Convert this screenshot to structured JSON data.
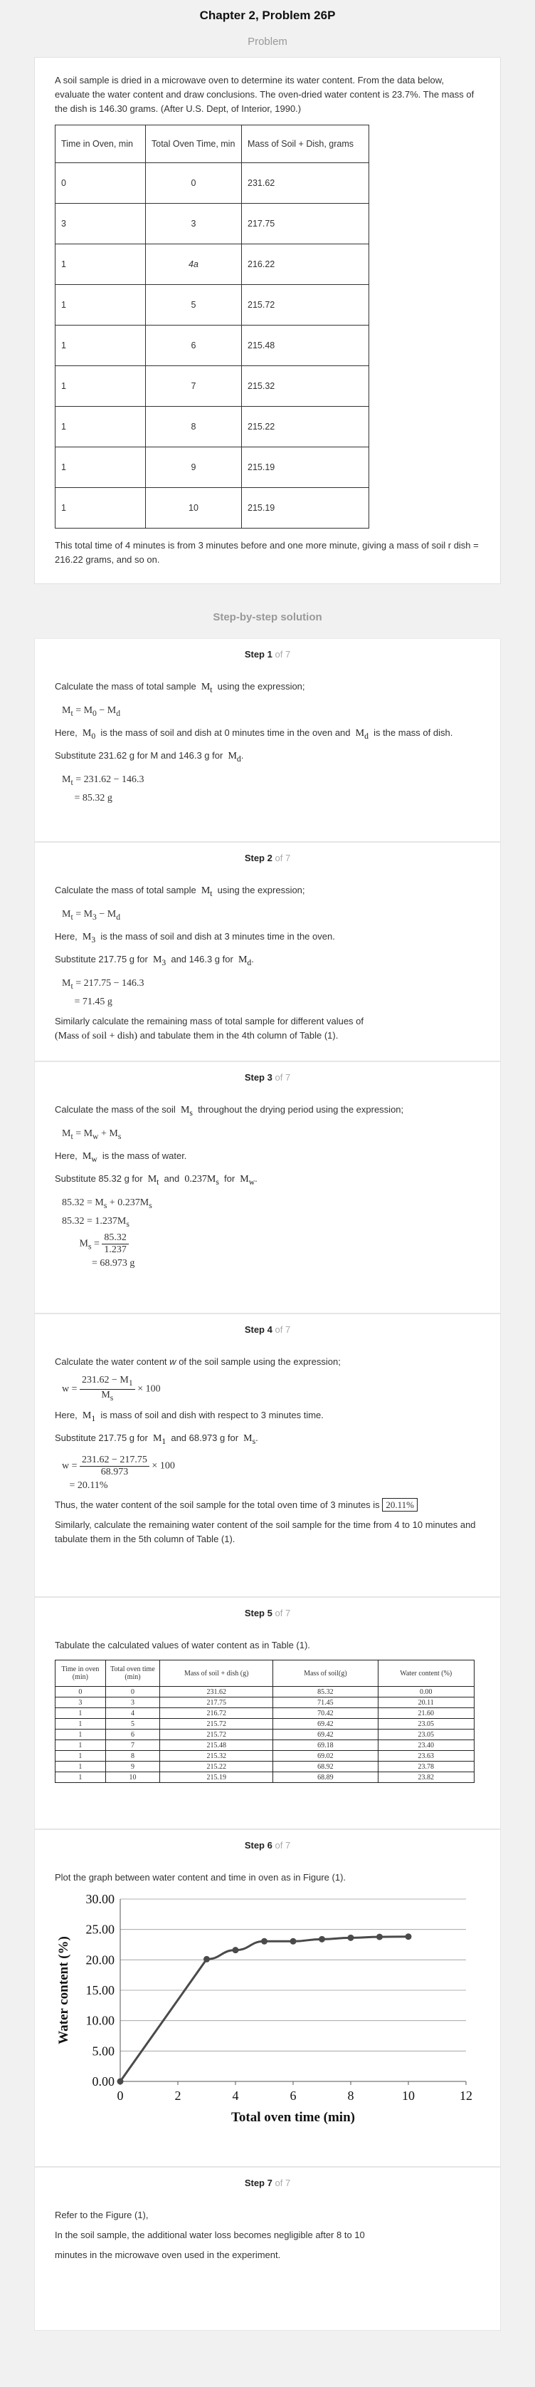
{
  "header": {
    "title": "Chapter 2, Problem 26P",
    "section": "Problem"
  },
  "problem": {
    "text": "A soil sample is dried in a microwave oven to determine its water content. From the data below, evaluate the water content and draw conclusions. The oven-dried water content is 23.7%. The mass of the dish is 146.30 grams. (After U.S. Dept, of Interior, 1990.)",
    "columns": [
      "Time in Oven, min",
      "Total Oven Time, min",
      "Mass of Soil + Dish, grams"
    ],
    "rows": [
      [
        "0",
        "0",
        "231.62"
      ],
      [
        "3",
        "3",
        "217.75"
      ],
      [
        "1",
        "4a",
        "216.22"
      ],
      [
        "1",
        "5",
        "215.72"
      ],
      [
        "1",
        "6",
        "215.48"
      ],
      [
        "1",
        "7",
        "215.32"
      ],
      [
        "1",
        "8",
        "215.22"
      ],
      [
        "1",
        "9",
        "215.19"
      ],
      [
        "1",
        "10",
        "215.19"
      ]
    ],
    "note": "This total time of 4 minutes is from 3 minutes before and one more minute, giving a mass of soil r dish = 216.22 grams, and so on."
  },
  "solution_title": "Step-by-step solution",
  "step_label": "Step",
  "of_total": "of 7",
  "steps": {
    "s1": {
      "num": "1",
      "intro": "Calculate the mass of total sample",
      "intro_sym": "M",
      "intro_sub": "t",
      "intro_end": "using the expression;",
      "eq": "M",
      "here1": "Here,",
      "here2": "is the mass of soil and dish at 0 minutes time in the oven and",
      "here3": "is the mass of dish.",
      "sub_text1": "Substitute 231.62 g for M and 146.3 g for",
      "line1": "= 231.62 − 146.3",
      "line2": "= 85.32 g"
    },
    "s2": {
      "num": "2",
      "intro": "Calculate the mass of total sample",
      "intro_end": "using the expression;",
      "here2": "is the mass of soil and dish at 3 minutes time in the oven.",
      "sub_text1": "Substitute 217.75 g for",
      "sub_text2": "and 146.3 g for",
      "line1": "= 217.75 − 146.3",
      "line2": "= 71.45 g",
      "similar1": "Similarly calculate the remaining mass of total sample for different values of",
      "similar_expr": "(Mass of soil + dish)",
      "similar2": "and tabulate them in the 4th column of Table (1)."
    },
    "s3": {
      "num": "3",
      "intro": "Calculate the mass of the soil",
      "intro_end": "throughout the drying period using the expression;",
      "here2": "is the mass of water.",
      "sub_text1": "Substitute 85.32 g for",
      "sub_text2": "and",
      "sub_expr": "0.237M",
      "sub_text3": "for",
      "line1": "85.32 = M",
      "line1b": "+ 0.237M",
      "line2": "85.32 = 1.237M",
      "frac_n": "85.32",
      "frac_d": "1.237",
      "line4": "= 68.973 g"
    },
    "s4": {
      "num": "4",
      "intro_a": "Calculate the water content",
      "intro_w": "w",
      "intro_b": "of the soil sample using the expression;",
      "eq_n": "231.62 − M",
      "eq_mult": "× 100",
      "here2": "is mass of soil and dish with respect to 3 minutes time.",
      "sub_text1": "Substitute 217.75 g for",
      "sub_text2": "and 68.973 g for",
      "frac2_n": "231.62 − 217.75",
      "frac2_d": "68.973",
      "result": "= 20.11%",
      "thus": "Thus, the water content of the soil sample for the total oven time of 3 minutes is",
      "thus_val": "20.11%",
      "similar": "Similarly, calculate the remaining water content of the soil sample for the time from 4 to 10 minutes and tabulate them in the 5th column of Table (1)."
    },
    "s5": {
      "num": "5",
      "intro": "Tabulate the calculated values of water content as in Table (1).",
      "columns": [
        "Time in oven (min)",
        "Total oven time (min)",
        "Mass of soil + dish (g)",
        "Mass of soil(g)",
        "Water content (%)"
      ],
      "rows": [
        [
          "0",
          "0",
          "231.62",
          "85.32",
          "0.00"
        ],
        [
          "3",
          "3",
          "217.75",
          "71.45",
          "20.11"
        ],
        [
          "1",
          "4",
          "216.72",
          "70.42",
          "21.60"
        ],
        [
          "1",
          "5",
          "215.72",
          "69.42",
          "23.05"
        ],
        [
          "1",
          "6",
          "215.72",
          "69.42",
          "23.05"
        ],
        [
          "1",
          "7",
          "215.48",
          "69.18",
          "23.40"
        ],
        [
          "1",
          "8",
          "215.32",
          "69.02",
          "23.63"
        ],
        [
          "1",
          "9",
          "215.22",
          "68.92",
          "23.78"
        ],
        [
          "1",
          "10",
          "215.19",
          "68.89",
          "23.82"
        ]
      ]
    },
    "s6": {
      "num": "6",
      "intro": "Plot the graph between water content and time in oven as in Figure (1)."
    },
    "s7": {
      "num": "7",
      "line1": "Refer to the Figure (1),",
      "line2": "In the soil sample, the additional water loss becomes negligible after 8 to 10",
      "line3": "minutes in the microwave oven used in the experiment."
    }
  },
  "chart_data": {
    "type": "line",
    "x": [
      0,
      3,
      4,
      5,
      6,
      7,
      8,
      9,
      10
    ],
    "series": [
      {
        "values": [
          0.0,
          20.11,
          21.6,
          23.05,
          23.05,
          23.4,
          23.63,
          23.78,
          23.82
        ]
      }
    ],
    "xlabel": "Total oven time (min)",
    "ylabel": "Water content (%)",
    "xlim": [
      0,
      12
    ],
    "ylim": [
      0,
      30
    ],
    "xticks": [
      "0",
      "2",
      "4",
      "6",
      "8",
      "10",
      "12"
    ],
    "yticks": [
      "0.00",
      "5.00",
      "10.00",
      "15.00",
      "20.00",
      "25.00",
      "30.00"
    ],
    "grid": "horizontal",
    "line_color": "#4a4a4a"
  }
}
